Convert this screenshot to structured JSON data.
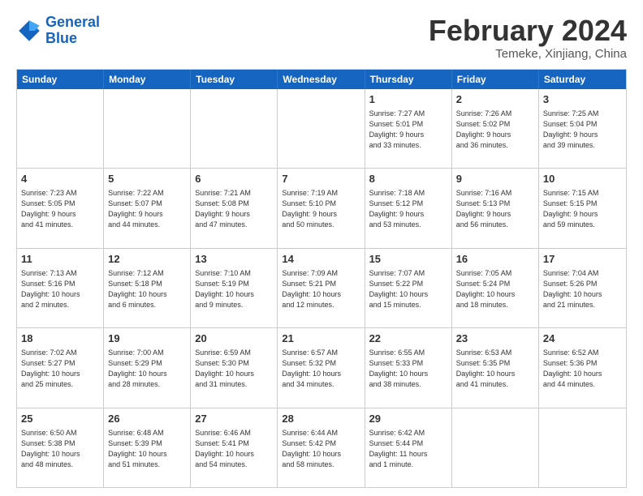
{
  "header": {
    "logo_general": "General",
    "logo_blue": "Blue",
    "month_title": "February 2024",
    "location": "Temeke, Xinjiang, China"
  },
  "days_of_week": [
    "Sunday",
    "Monday",
    "Tuesday",
    "Wednesday",
    "Thursday",
    "Friday",
    "Saturday"
  ],
  "rows": [
    [
      {
        "day": "",
        "info": ""
      },
      {
        "day": "",
        "info": ""
      },
      {
        "day": "",
        "info": ""
      },
      {
        "day": "",
        "info": ""
      },
      {
        "day": "1",
        "info": "Sunrise: 7:27 AM\nSunset: 5:01 PM\nDaylight: 9 hours\nand 33 minutes."
      },
      {
        "day": "2",
        "info": "Sunrise: 7:26 AM\nSunset: 5:02 PM\nDaylight: 9 hours\nand 36 minutes."
      },
      {
        "day": "3",
        "info": "Sunrise: 7:25 AM\nSunset: 5:04 PM\nDaylight: 9 hours\nand 39 minutes."
      }
    ],
    [
      {
        "day": "4",
        "info": "Sunrise: 7:23 AM\nSunset: 5:05 PM\nDaylight: 9 hours\nand 41 minutes."
      },
      {
        "day": "5",
        "info": "Sunrise: 7:22 AM\nSunset: 5:07 PM\nDaylight: 9 hours\nand 44 minutes."
      },
      {
        "day": "6",
        "info": "Sunrise: 7:21 AM\nSunset: 5:08 PM\nDaylight: 9 hours\nand 47 minutes."
      },
      {
        "day": "7",
        "info": "Sunrise: 7:19 AM\nSunset: 5:10 PM\nDaylight: 9 hours\nand 50 minutes."
      },
      {
        "day": "8",
        "info": "Sunrise: 7:18 AM\nSunset: 5:12 PM\nDaylight: 9 hours\nand 53 minutes."
      },
      {
        "day": "9",
        "info": "Sunrise: 7:16 AM\nSunset: 5:13 PM\nDaylight: 9 hours\nand 56 minutes."
      },
      {
        "day": "10",
        "info": "Sunrise: 7:15 AM\nSunset: 5:15 PM\nDaylight: 9 hours\nand 59 minutes."
      }
    ],
    [
      {
        "day": "11",
        "info": "Sunrise: 7:13 AM\nSunset: 5:16 PM\nDaylight: 10 hours\nand 2 minutes."
      },
      {
        "day": "12",
        "info": "Sunrise: 7:12 AM\nSunset: 5:18 PM\nDaylight: 10 hours\nand 6 minutes."
      },
      {
        "day": "13",
        "info": "Sunrise: 7:10 AM\nSunset: 5:19 PM\nDaylight: 10 hours\nand 9 minutes."
      },
      {
        "day": "14",
        "info": "Sunrise: 7:09 AM\nSunset: 5:21 PM\nDaylight: 10 hours\nand 12 minutes."
      },
      {
        "day": "15",
        "info": "Sunrise: 7:07 AM\nSunset: 5:22 PM\nDaylight: 10 hours\nand 15 minutes."
      },
      {
        "day": "16",
        "info": "Sunrise: 7:05 AM\nSunset: 5:24 PM\nDaylight: 10 hours\nand 18 minutes."
      },
      {
        "day": "17",
        "info": "Sunrise: 7:04 AM\nSunset: 5:26 PM\nDaylight: 10 hours\nand 21 minutes."
      }
    ],
    [
      {
        "day": "18",
        "info": "Sunrise: 7:02 AM\nSunset: 5:27 PM\nDaylight: 10 hours\nand 25 minutes."
      },
      {
        "day": "19",
        "info": "Sunrise: 7:00 AM\nSunset: 5:29 PM\nDaylight: 10 hours\nand 28 minutes."
      },
      {
        "day": "20",
        "info": "Sunrise: 6:59 AM\nSunset: 5:30 PM\nDaylight: 10 hours\nand 31 minutes."
      },
      {
        "day": "21",
        "info": "Sunrise: 6:57 AM\nSunset: 5:32 PM\nDaylight: 10 hours\nand 34 minutes."
      },
      {
        "day": "22",
        "info": "Sunrise: 6:55 AM\nSunset: 5:33 PM\nDaylight: 10 hours\nand 38 minutes."
      },
      {
        "day": "23",
        "info": "Sunrise: 6:53 AM\nSunset: 5:35 PM\nDaylight: 10 hours\nand 41 minutes."
      },
      {
        "day": "24",
        "info": "Sunrise: 6:52 AM\nSunset: 5:36 PM\nDaylight: 10 hours\nand 44 minutes."
      }
    ],
    [
      {
        "day": "25",
        "info": "Sunrise: 6:50 AM\nSunset: 5:38 PM\nDaylight: 10 hours\nand 48 minutes."
      },
      {
        "day": "26",
        "info": "Sunrise: 6:48 AM\nSunset: 5:39 PM\nDaylight: 10 hours\nand 51 minutes."
      },
      {
        "day": "27",
        "info": "Sunrise: 6:46 AM\nSunset: 5:41 PM\nDaylight: 10 hours\nand 54 minutes."
      },
      {
        "day": "28",
        "info": "Sunrise: 6:44 AM\nSunset: 5:42 PM\nDaylight: 10 hours\nand 58 minutes."
      },
      {
        "day": "29",
        "info": "Sunrise: 6:42 AM\nSunset: 5:44 PM\nDaylight: 11 hours\nand 1 minute."
      },
      {
        "day": "",
        "info": ""
      },
      {
        "day": "",
        "info": ""
      }
    ]
  ]
}
